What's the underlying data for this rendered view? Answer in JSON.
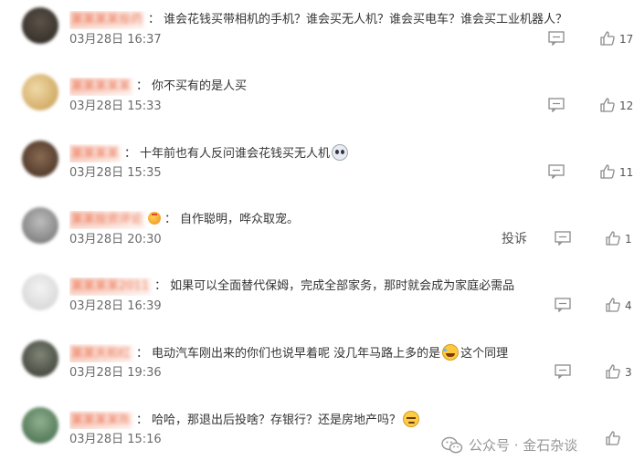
{
  "comments": [
    {
      "username": "某某某某投药",
      "text": "谁会花钱买带相机的手机？谁会买无人机？谁会买电车？谁会买工业机器人？",
      "time": "03月28日 16:37",
      "likes": "17",
      "avatar_color": "#3a342e"
    },
    {
      "username": "某某某某某",
      "text": "你不买有的是人买",
      "time": "03月28日 15:33",
      "likes": "12",
      "avatar_color": "#d9b26a"
    },
    {
      "username": "某某某某",
      "text": "十年前也有人反问谁会花钱买无人机",
      "time": "03月28日 15:35",
      "likes": "11",
      "avatar_color": "#6b4a35",
      "emoji": "cry-emoji"
    },
    {
      "username": "某某投资评论",
      "text": "自作聪明，哗众取宠。",
      "time": "03月28日 20:30",
      "likes": "1",
      "avatar_color": "#8a8a8a",
      "report_label": "投诉",
      "badge": "crown-badge"
    },
    {
      "username": "某某某某2011",
      "text": "如果可以全面替代保姆，完成全部家务，那时就会成为家庭必需品",
      "time": "03月28日 16:39",
      "likes": "4",
      "avatar_color": "#e4e4e4"
    },
    {
      "username": "某某天和红",
      "text_before": "电动汽车刚出来的你们也说早着呢 没几年马路上多的是",
      "text_after": "这个同理",
      "time": "03月28日 19:36",
      "likes": "3",
      "avatar_color": "#5a5f52",
      "emoji": "laugh-emoji"
    },
    {
      "username": "某某某某陈",
      "text": "哈哈，那退出后投啥？存银行？还是房地产吗？",
      "time": "03月28日 15:16",
      "likes": "",
      "avatar_color": "#4c7a55",
      "emoji": "smirk-emoji"
    }
  ],
  "separator": "：",
  "watermark": {
    "text": "公众号 · 金石杂谈",
    "icon": "wechat-icon"
  },
  "colors": {
    "username": "#eb7350",
    "time": "#6b6b6b",
    "icon": "#8a8a8a"
  }
}
